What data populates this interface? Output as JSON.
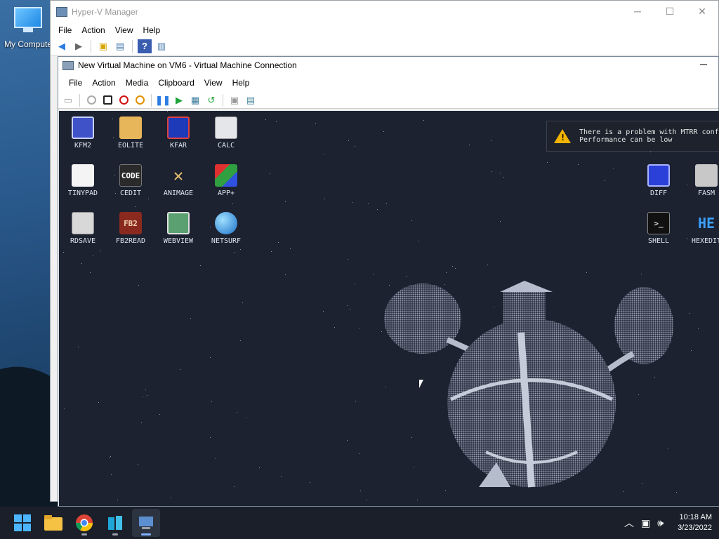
{
  "host": {
    "desktop_icon_label": "My Compute"
  },
  "hyperv": {
    "title": "Hyper-V Manager",
    "controls": {
      "minimize": "─",
      "maximize": "☐",
      "close": "✕"
    },
    "menu": [
      "File",
      "Action",
      "View",
      "Help"
    ]
  },
  "vm": {
    "title": "New Virtual Machine on VM6 - Virtual Machine Connection",
    "minimize": "─",
    "menu": [
      "File",
      "Action",
      "Media",
      "Clipboard",
      "View",
      "Help"
    ]
  },
  "guest": {
    "icons_left": [
      {
        "label": "KFM2"
      },
      {
        "label": "EOLITE"
      },
      {
        "label": "KFAR"
      },
      {
        "label": "CALC"
      },
      {
        "label": "TINYPAD"
      },
      {
        "label": "CEDIT"
      },
      {
        "label": "ANIMAGE"
      },
      {
        "label": "APP+"
      },
      {
        "label": "RDSAVE"
      },
      {
        "label": "FB2READ"
      },
      {
        "label": "WEBVIEW"
      },
      {
        "label": "NETSURF"
      }
    ],
    "icons_right": [
      {
        "label": "DIFF"
      },
      {
        "label": "FASM"
      },
      {
        "label": "SHELL"
      },
      {
        "label": "HEXEDIT"
      }
    ],
    "icon_glyphs": {
      "cedit": "CODE",
      "fb2read": "FB2",
      "hexedit": "HE",
      "shell": ">_"
    },
    "notification": {
      "line1": "There is a problem with MTRR confi",
      "line2": "Performance can be low"
    }
  },
  "taskbar": {
    "time": "10:18 AM",
    "date": "3/23/2022"
  },
  "colors": {
    "guest_bg": "#1c2230",
    "warning": "#f2b400",
    "taskbar": "#1a1f2a"
  }
}
